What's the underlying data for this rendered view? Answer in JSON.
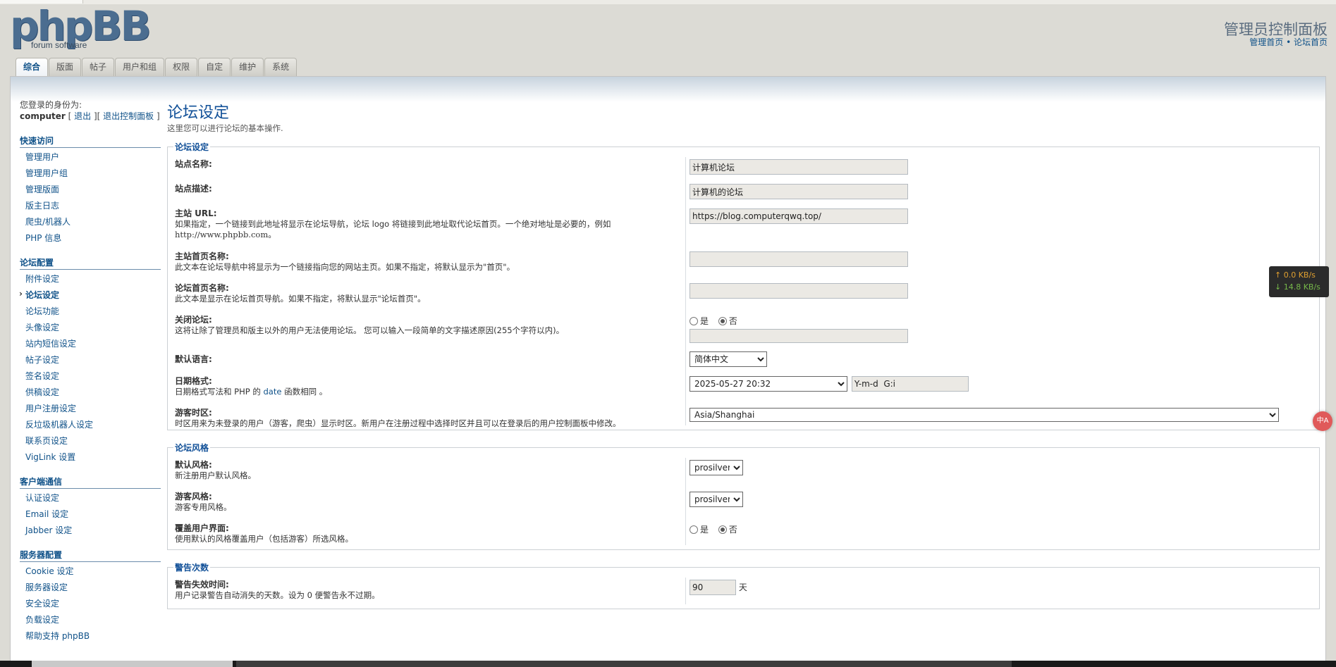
{
  "logo": {
    "wordmark": "phpBB",
    "tagline": "forum software"
  },
  "header": {
    "title": "管理员控制面板",
    "crumbs": [
      "管理首页",
      "论坛首页"
    ],
    "crumb_sep": "•"
  },
  "tabs": [
    {
      "label": "综合",
      "active": true
    },
    {
      "label": "版面",
      "active": false
    },
    {
      "label": "帖子",
      "active": false
    },
    {
      "label": "用户和组",
      "active": false
    },
    {
      "label": "权限",
      "active": false
    },
    {
      "label": "自定",
      "active": false
    },
    {
      "label": "维护",
      "active": false
    },
    {
      "label": "系统",
      "active": false
    }
  ],
  "user": {
    "logged_as": "您登录的身份为:",
    "name": "computer",
    "logout": "退出",
    "logout_acp": "退出控制面板"
  },
  "menu": [
    {
      "head": "快速访问",
      "items": [
        "管理用户",
        "管理用户组",
        "管理版面",
        "版主日志",
        "爬虫/机器人",
        "PHP 信息"
      ]
    },
    {
      "head": "论坛配置",
      "items": [
        "附件设定",
        "论坛设定",
        "论坛功能",
        "头像设定",
        "站内短信设定",
        "帖子设定",
        "签名设定",
        "供稿设定",
        "用户注册设定",
        "反垃圾机器人设定",
        "联系页设定",
        "VigLink 设置"
      ],
      "active": "论坛设定"
    },
    {
      "head": "客户端通信",
      "items": [
        "认证设定",
        "Email 设定",
        "Jabber 设定"
      ]
    },
    {
      "head": "服务器配置",
      "items": [
        "Cookie 设定",
        "服务器设定",
        "安全设定",
        "负载设定",
        "帮助支持 phpBB"
      ]
    }
  ],
  "page": {
    "title": "论坛设定",
    "explain": "这里您可以进行论坛的基本操作."
  },
  "section1": {
    "legend": "论坛设定",
    "site_name": {
      "label": "站点名称:",
      "value": "计算机论坛"
    },
    "site_desc": {
      "label": "站点描述:",
      "value": "计算机的论坛"
    },
    "site_url": {
      "label": "主站 URL:",
      "desc": "如果指定，一个链接到此地址将显示在论坛导航，论坛 logo 将链接到此地址取代论坛首页。一个绝对地址是必要的，例如",
      "example": "http://www.phpbb.com。",
      "value": "https://blog.computerqwq.top/"
    },
    "site_home": {
      "label": "主站首页名称:",
      "desc": "此文本在论坛导航中将显示为一个链接指向您的网站主页。如果不指定，将默认显示为\"首页\"。",
      "value": ""
    },
    "board_index": {
      "label": "论坛首页名称:",
      "desc": "此文本是显示在论坛首页导航。如果不指定，将默认显示\"论坛首页\"。",
      "value": ""
    },
    "disable": {
      "label": "关闭论坛:",
      "desc": "这将让除了管理员和版主以外的用户无法使用论坛。 您可以输入一段简单的文字描述原因(255个字符以内)。",
      "yes": "是",
      "no": "否",
      "msg": ""
    },
    "lang": {
      "label": "默认语言:",
      "value": "简体中文"
    },
    "date": {
      "label": "日期格式:",
      "desc_pre": "日期格式写法和 PHP 的",
      "desc_link": "date",
      "desc_post": "函数相同 。",
      "value": "2025-05-27 20:32",
      "format": "Y-m-d  G:i"
    },
    "tz": {
      "label": "游客时区:",
      "desc": "时区用来为未登录的用户（游客，爬虫）显示时区。新用户在注册过程中选择时区并且可以在登录后的用户控制面板中修改。",
      "value": "Asia/Shanghai"
    }
  },
  "section2": {
    "legend": "论坛风格",
    "default_style": {
      "label": "默认风格:",
      "desc": "新注册用户默认风格。",
      "value": "prosilver"
    },
    "guest_style": {
      "label": "游客风格:",
      "desc": "游客专用风格。",
      "value": "prosilver"
    },
    "override": {
      "label": "覆盖用户界面:",
      "desc": "使用默认的风格覆盖用户（包括游客）所选风格。",
      "yes": "是",
      "no": "否"
    }
  },
  "section3": {
    "legend": "警告次数",
    "expire": {
      "label": "警告失效时间:",
      "desc": "用户记录警告自动消失的天数。设为 0 便警告永不过期。",
      "value": "90",
      "unit": "天"
    }
  },
  "netmon": {
    "up": "↑ 0.0 KB/s",
    "down": "↓ 14.8 KB/s"
  },
  "float_btn": "中A"
}
